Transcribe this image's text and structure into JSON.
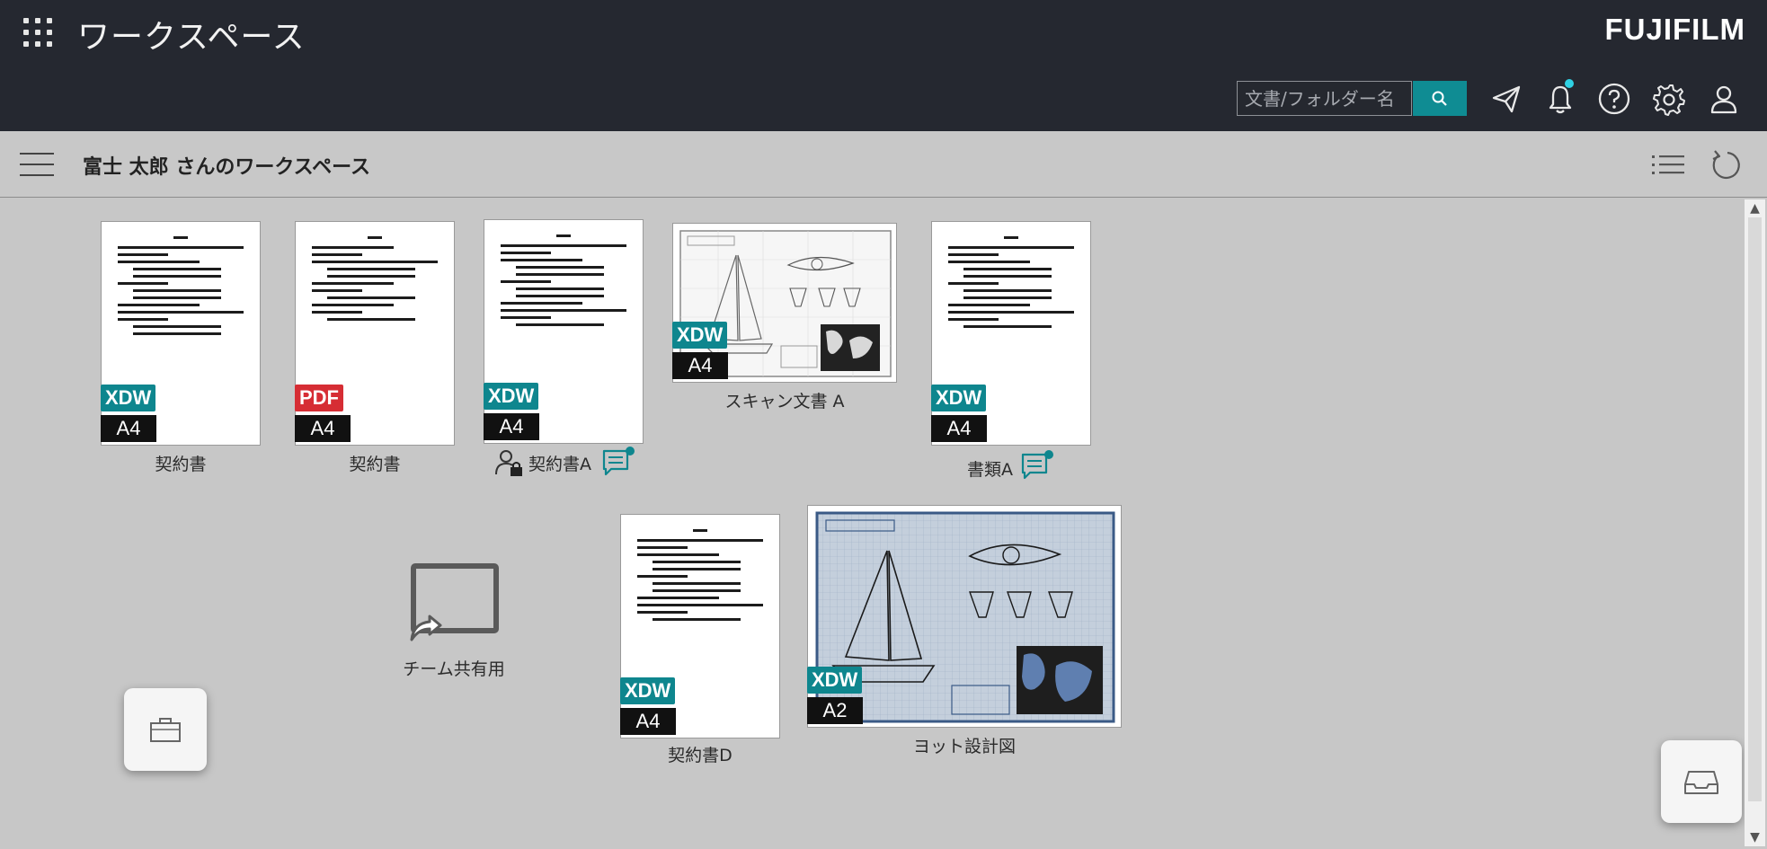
{
  "header": {
    "app_title": "ワークスペース",
    "brand": "FUJIFILM",
    "search_placeholder": "文書/フォルダー名",
    "icons": [
      "apps-grid-icon",
      "search-icon",
      "send-icon",
      "bell-icon",
      "help-icon",
      "gear-icon",
      "user-icon"
    ],
    "notification_dot_color": "#2fd1e3",
    "accent_color": "#0f8c93"
  },
  "toolbar": {
    "workspace_title": "富士 太郎 さんのワークスペース",
    "icons": [
      "hamburger-menu-icon",
      "list-view-icon",
      "refresh-icon"
    ]
  },
  "documents": [
    {
      "name": "契約書",
      "type": "XDW",
      "size": "A4",
      "kind": "text"
    },
    {
      "name": "契約書",
      "type": "PDF",
      "size": "A4",
      "kind": "text"
    },
    {
      "name": "契約書A",
      "type": "XDW",
      "size": "A4",
      "kind": "text",
      "locked": true,
      "has_comment": true
    },
    {
      "name": "スキャン文書 A",
      "type": "XDW",
      "size": "A4",
      "kind": "drawing"
    },
    {
      "name": "書類A",
      "type": "XDW",
      "size": "A4",
      "kind": "text",
      "has_comment": true
    },
    {
      "name": "契約書D",
      "type": "XDW",
      "size": "A4",
      "kind": "text"
    },
    {
      "name": "ヨット設計図",
      "type": "XDW",
      "size": "A2",
      "kind": "blueprint"
    }
  ],
  "folders": [
    {
      "name": "チーム共有用",
      "shared": true
    }
  ],
  "floating_buttons": [
    "briefcase-icon",
    "tray-icon"
  ],
  "badge_colors": {
    "XDW": "#0e868e",
    "PDF": "#d62d34",
    "size": "#111111"
  }
}
